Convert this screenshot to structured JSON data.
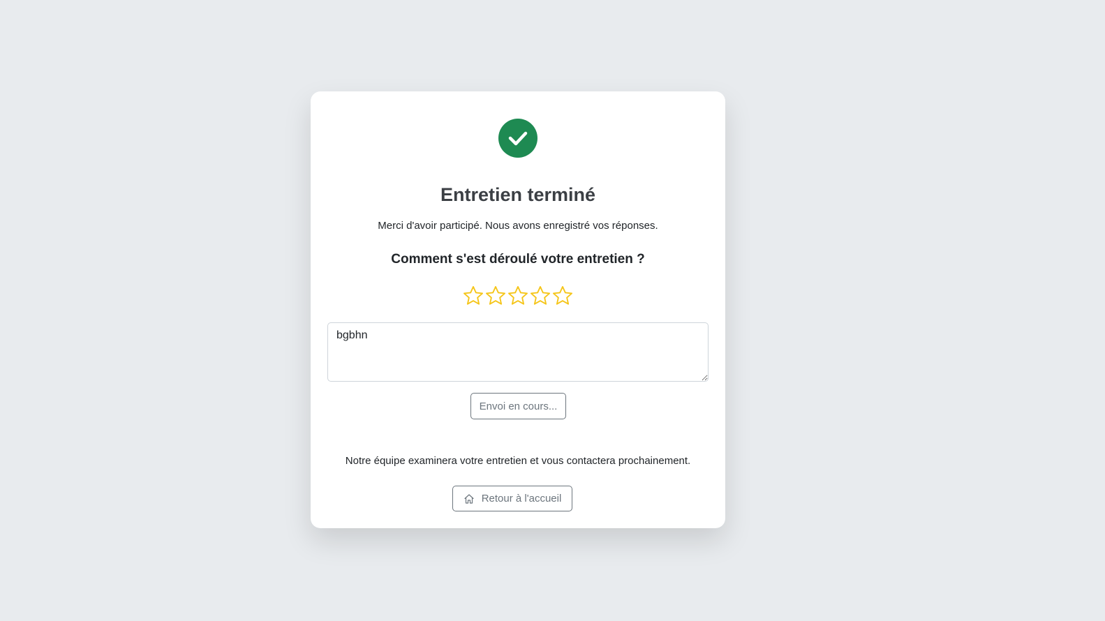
{
  "card": {
    "title": "Entretien terminé",
    "subtitle": "Merci d'avoir participé. Nous avons enregistré vos réponses.",
    "question": "Comment s'est déroulé votre entretien ?",
    "rating": {
      "max": 5,
      "selected": 0
    },
    "feedback_value": "bgbhn",
    "submit_label": "Envoi en cours...",
    "note": "Notre équipe examinera votre entretien et vous contactera prochainement.",
    "home_label": "Retour à l'accueil"
  },
  "icons": {
    "success": "check-circle-icon",
    "star": "star-outline-icon",
    "home": "home-icon"
  },
  "colors": {
    "background": "#e8ebee",
    "success_green": "#1e8a52",
    "star_gold": "#f5c518",
    "muted_gray": "#6c757d"
  }
}
